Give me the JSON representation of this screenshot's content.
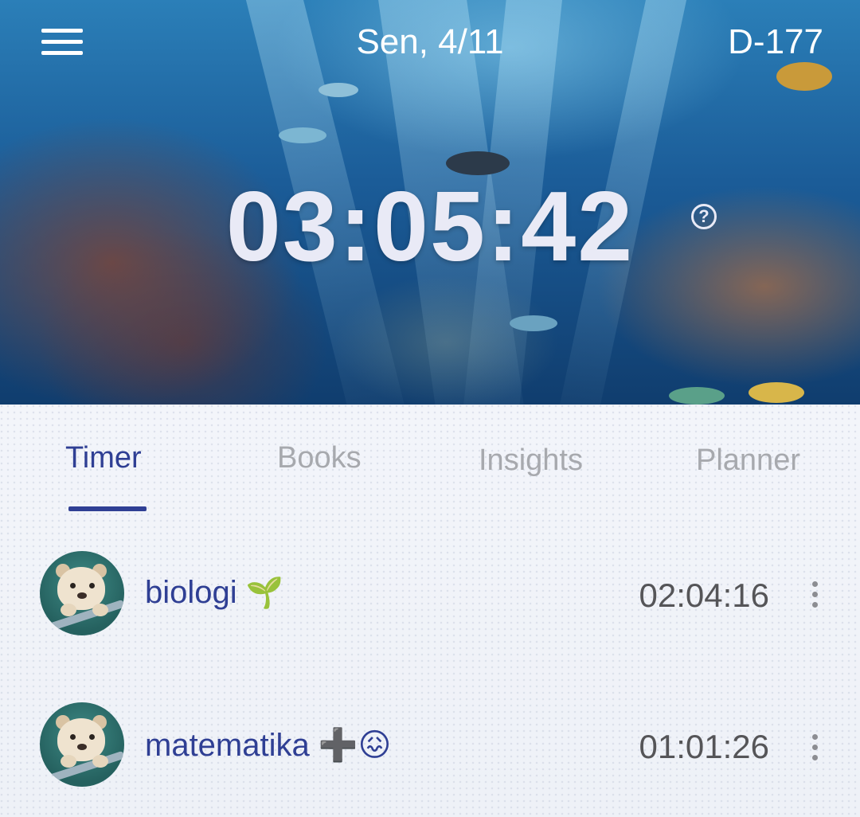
{
  "header": {
    "date": "Sen, 4/11",
    "dday": "D-177",
    "total_time": "03:05:42",
    "help_symbol": "?"
  },
  "icons": {
    "menu": "menu-icon",
    "help": "help-circle-icon",
    "more": "more-vertical-icon"
  },
  "tabs": [
    {
      "label": "Timer",
      "active": true
    },
    {
      "label": "Books",
      "active": false
    },
    {
      "label": "Insights",
      "active": false
    },
    {
      "label": "Planner",
      "active": false
    }
  ],
  "subjects": [
    {
      "name": "biologi",
      "emoji": "🌱",
      "time": "02:04:16"
    },
    {
      "name": "matematika",
      "emoji": "➕😖",
      "time": "01:01:26"
    }
  ],
  "colors": {
    "accent": "#2f3f94",
    "tab_inactive": "#a7a9ae",
    "timer_text": "#e9eaf6",
    "time_text": "#555558"
  }
}
